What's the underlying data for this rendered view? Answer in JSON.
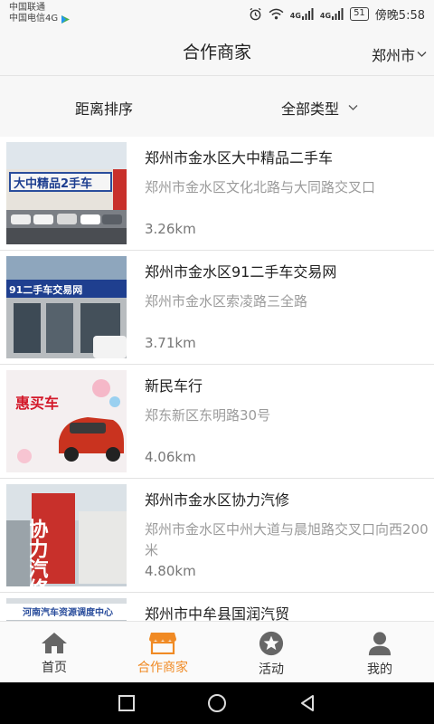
{
  "status_bar": {
    "carrier1": "中国联通",
    "carrier2": "中国电信4G",
    "net1": "4G",
    "net2": "4G",
    "battery": "51",
    "time": "傍晚5:58"
  },
  "header": {
    "title": "合作商家",
    "city": "郑州市"
  },
  "filters": {
    "sort": "距离排序",
    "type": "全部类型"
  },
  "merchants": [
    {
      "name": "郑州市金水区大中精品二手车",
      "address": "郑州市金水区文化北路与大同路交叉口",
      "distance": "3.26km",
      "sign": "大中精品2手车"
    },
    {
      "name": "郑州市金水区91二手车交易网",
      "address": "郑州市金水区索凌路三全路",
      "distance": "3.71km",
      "sign": "91二手车交易网"
    },
    {
      "name": "新民车行",
      "address": "郑东新区东明路30号",
      "distance": "4.06km",
      "sign": "惠买车"
    },
    {
      "name": "郑州市金水区协力汽修",
      "address": "郑州市金水区中州大道与晨旭路交叉口向西200米",
      "distance": "4.80km",
      "sign": "协力汽修"
    },
    {
      "name": "郑州市中牟县国润汽贸",
      "address": "",
      "distance": "",
      "sign": "河南汽车资源调度中心"
    }
  ],
  "tabs": [
    {
      "label": "首页",
      "icon": "home-icon"
    },
    {
      "label": "合作商家",
      "icon": "store-icon"
    },
    {
      "label": "活动",
      "icon": "star-icon"
    },
    {
      "label": "我的",
      "icon": "profile-icon"
    }
  ],
  "colors": {
    "accent": "#f08a24",
    "text": "#222222",
    "muted": "#9b9b9b"
  }
}
